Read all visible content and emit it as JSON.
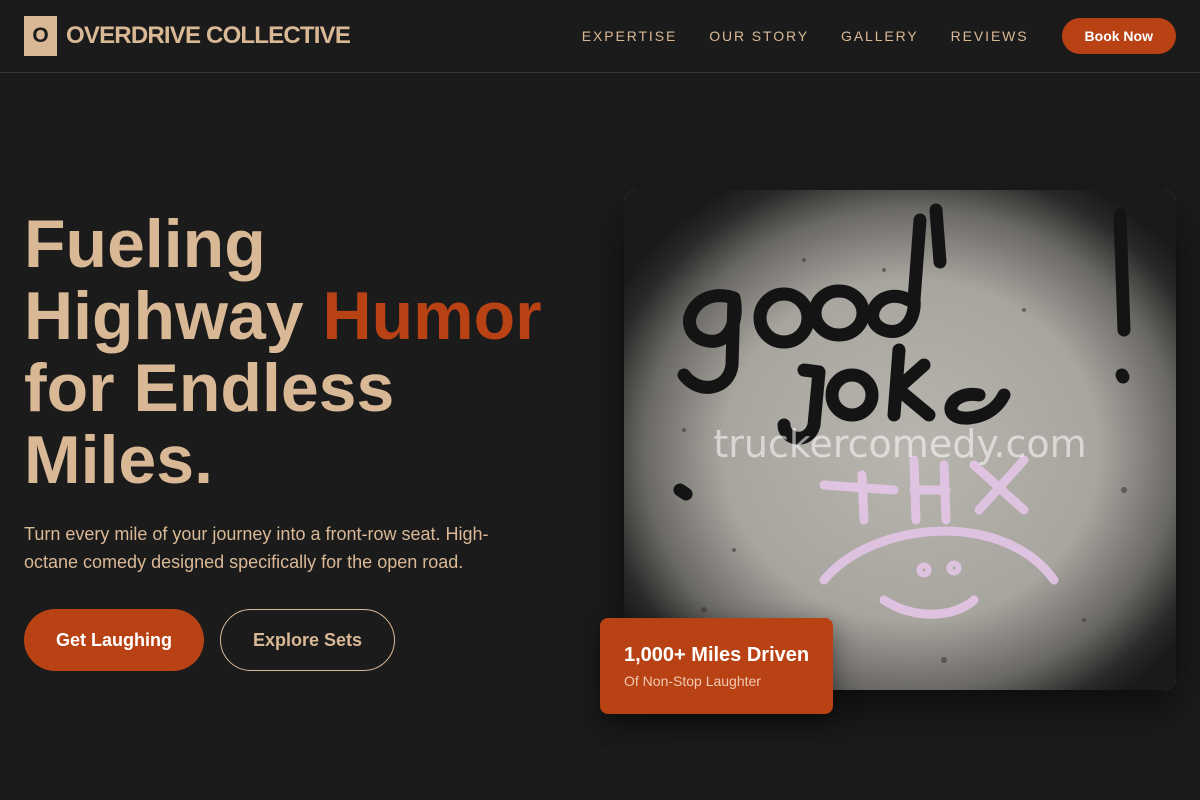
{
  "header": {
    "logo_letter": "O",
    "brand_name": "OVERDRIVE COLLECTIVE",
    "nav": [
      "EXPERTISE",
      "OUR STORY",
      "GALLERY",
      "REVIEWS"
    ],
    "book_label": "Book Now"
  },
  "hero": {
    "headline_1": "Fueling",
    "headline_2": "Highway ",
    "headline_accent": "Humor",
    "headline_3": "for Endless",
    "headline_4": "Miles.",
    "subtext": "Turn every mile of your journey into a front-row seat. High-octane comedy designed specifically for the open road.",
    "primary_cta": "Get Laughing",
    "secondary_cta": "Explore Sets"
  },
  "image": {
    "graffiti_main": "good joke!",
    "graffiti_sub": "THX",
    "watermark": "truckercomedy.com"
  },
  "stat": {
    "title": "1,000+ Miles Driven",
    "subtitle": "Of Non-Stop Laughter"
  },
  "colors": {
    "background": "#1c1b1b",
    "primary_text": "#d9b896",
    "accent": "#b94214"
  }
}
